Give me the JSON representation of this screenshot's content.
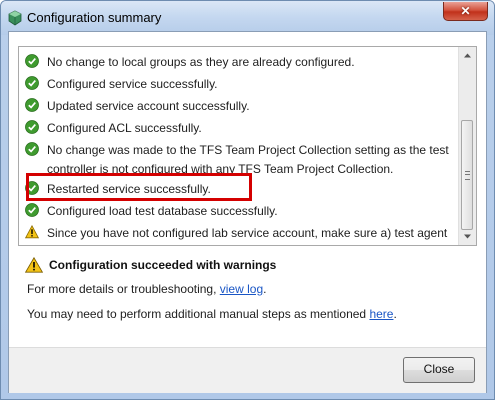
{
  "window": {
    "title": "Configuration summary",
    "close_glyph": "✕",
    "icon": "configuration-wizard-icon"
  },
  "log": {
    "items": [
      {
        "status": "success",
        "icon": "green-check-icon",
        "text": "No change to local groups as they are already configured."
      },
      {
        "status": "success",
        "icon": "green-check-icon",
        "text": "Configured service successfully."
      },
      {
        "status": "success",
        "icon": "green-check-icon",
        "text": "Updated service account successfully."
      },
      {
        "status": "success",
        "icon": "green-check-icon",
        "text": "Configured ACL successfully."
      },
      {
        "status": "success",
        "icon": "green-check-icon",
        "text": "No change was made to the TFS Team Project Collection setting as the test controller is not configured with any TFS Team Project Collection."
      },
      {
        "status": "success",
        "icon": "green-check-icon",
        "text": "Restarted service successfully."
      },
      {
        "status": "success",
        "icon": "green-check-icon",
        "text": "Configured load test database successfully."
      },
      {
        "status": "warning",
        "icon": "warning-icon",
        "text": "Since you have not configured lab service account, make sure a) test agent can communicate with the test controller, b) test controller and test agent"
      }
    ]
  },
  "summary": {
    "icon": "warning-icon",
    "text": "Configuration succeeded with warnings"
  },
  "details": {
    "prefix": "For more details or troubleshooting, ",
    "link": "view log",
    "suffix": "."
  },
  "manual": {
    "prefix": "You may need to perform additional manual steps as mentioned ",
    "link": "here",
    "suffix": "."
  },
  "buttons": {
    "close": "Close"
  },
  "colors": {
    "success": "#3f9b2f",
    "warning": "#f3c316",
    "link": "#1a56c5",
    "highlight": "#d40000"
  }
}
